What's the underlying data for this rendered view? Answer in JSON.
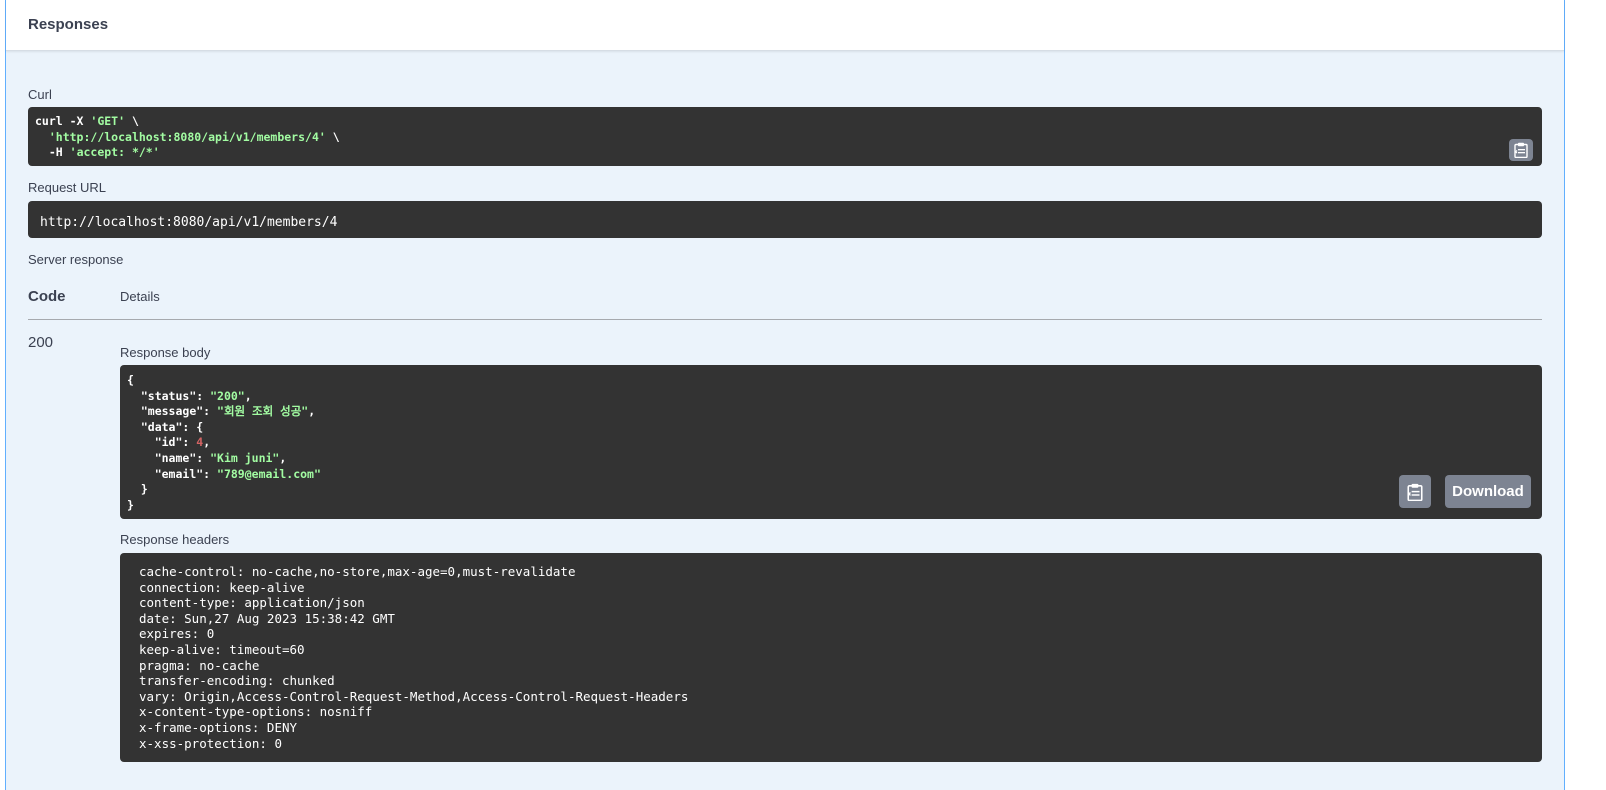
{
  "panel": {
    "title": "Responses"
  },
  "curl": {
    "label": "Curl",
    "line1_prefix": "curl -X ",
    "line1_method": "'GET'",
    "line1_suffix": " \\",
    "line2_url": "'http://localhost:8080/api/v1/members/4'",
    "line2_suffix": " \\",
    "line3_prefix": "-H ",
    "line3_header": "'accept: */*'"
  },
  "request_url": {
    "label": "Request URL",
    "value": "http://localhost:8080/api/v1/members/4"
  },
  "server_response": {
    "label": "Server response",
    "code_header": "Code",
    "details_header": "Details",
    "code": "200",
    "body_label": "Response body",
    "body": {
      "status_key": "\"status\"",
      "status_val": "\"200\"",
      "message_key": "\"message\"",
      "message_val": "\"회원 조회 성공\"",
      "data_key": "\"data\"",
      "id_key": "\"id\"",
      "id_val": "4",
      "name_key": "\"name\"",
      "name_val": "\"Kim juni\"",
      "email_key": "\"email\"",
      "email_val": "\"789@email.com\""
    },
    "download_label": "Download",
    "headers_label": "Response headers",
    "headers": [
      "cache-control: no-cache,no-store,max-age=0,must-revalidate",
      "connection: keep-alive",
      "content-type: application/json",
      "date: Sun,27 Aug 2023 15:38:42 GMT",
      "expires: 0",
      "keep-alive: timeout=60",
      "pragma: no-cache",
      "transfer-encoding: chunked",
      "vary: Origin,Access-Control-Request-Method,Access-Control-Request-Headers",
      "x-content-type-options: nosniff",
      "x-frame-options: DENY",
      "x-xss-protection: 0"
    ]
  },
  "icons": {
    "copy": "clipboard-icon"
  },
  "colors": {
    "code_bg": "#333333",
    "panel_bg": "#ebf3fb",
    "string": "#a2fca2",
    "number": "#d36363",
    "button": "#7d8492"
  }
}
